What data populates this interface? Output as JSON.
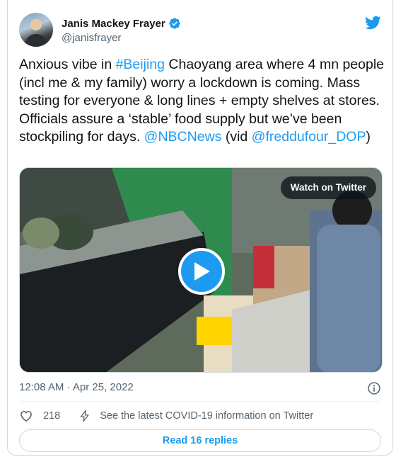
{
  "author": {
    "name": "Janis Mackey Frayer",
    "handle": "@janisfrayer",
    "verified": true
  },
  "tweet": {
    "segments": [
      {
        "text": "Anxious vibe in ",
        "link": false
      },
      {
        "text": "#Beijing",
        "link": true
      },
      {
        "text": " Chaoyang area where 4 mn people (incl me & my family) worry a lockdown is coming. Mass testing for everyone & long lines + empty shelves at stores. Officials assure a ‘stable’ food supply but we’ve been stockpiling for days. ",
        "link": false
      },
      {
        "text": "@NBCNews",
        "link": true
      },
      {
        "text": " (vid ",
        "link": false
      },
      {
        "text": "@freddufour_DOP",
        "link": true
      },
      {
        "text": ")",
        "link": false
      }
    ]
  },
  "media": {
    "watch_label": "Watch on Twitter",
    "scene": "supermarket-empty-shelves-video"
  },
  "meta": {
    "timestamp": "12:08 AM · Apr 25, 2022"
  },
  "actions": {
    "likes": "218",
    "covid_notice": "See the latest COVID-19 information on Twitter"
  },
  "replies_label": "Read 16 replies",
  "colors": {
    "accent": "#1d9bf0",
    "text": "#0f1419",
    "muted": "#536471",
    "border": "#cfd9de"
  },
  "icons": [
    "verified-badge-icon",
    "twitter-bird-icon",
    "play-icon",
    "info-icon",
    "heart-icon",
    "lightning-icon"
  ]
}
